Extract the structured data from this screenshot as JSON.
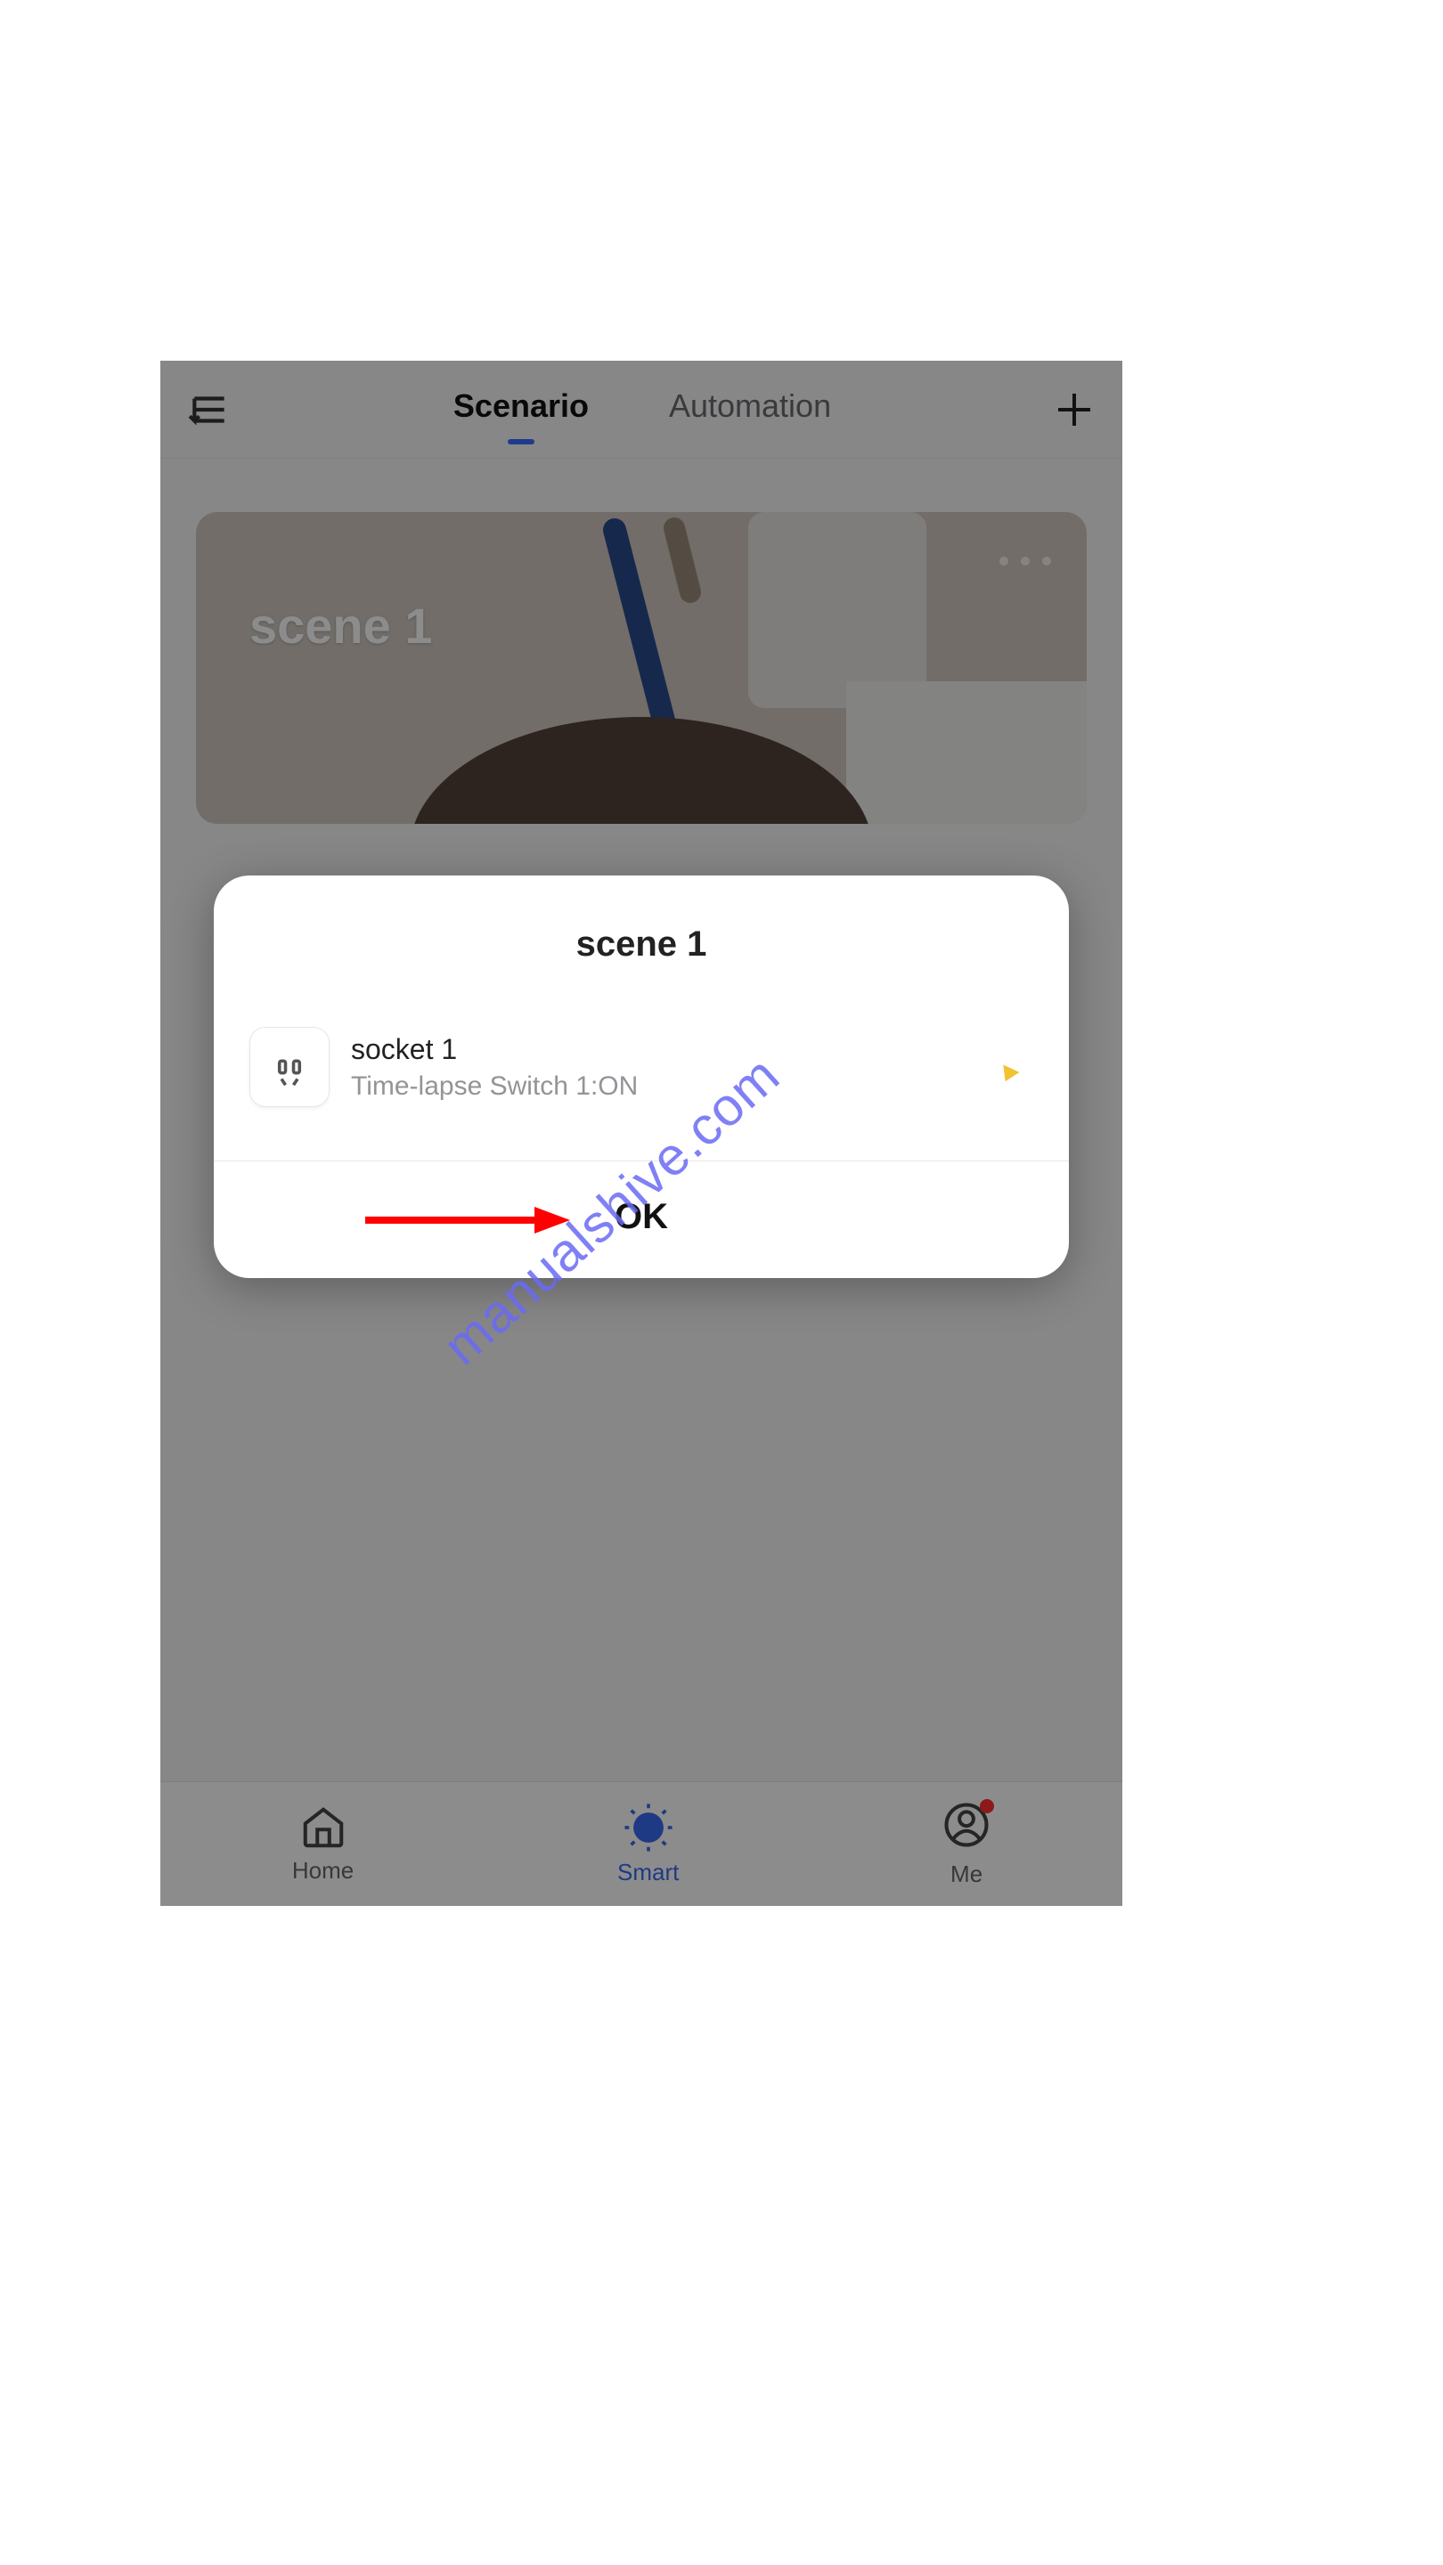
{
  "header": {
    "tabs": {
      "scenario": "Scenario",
      "automation": "Automation"
    }
  },
  "scene_card": {
    "title": "scene 1"
  },
  "modal": {
    "title": "scene 1",
    "device_name": "socket 1",
    "device_sub": "Time-lapse Switch 1:ON",
    "ok_label": "OK"
  },
  "bottomnav": {
    "home": "Home",
    "smart": "Smart",
    "me": "Me"
  },
  "watermark": "manualshive.com"
}
